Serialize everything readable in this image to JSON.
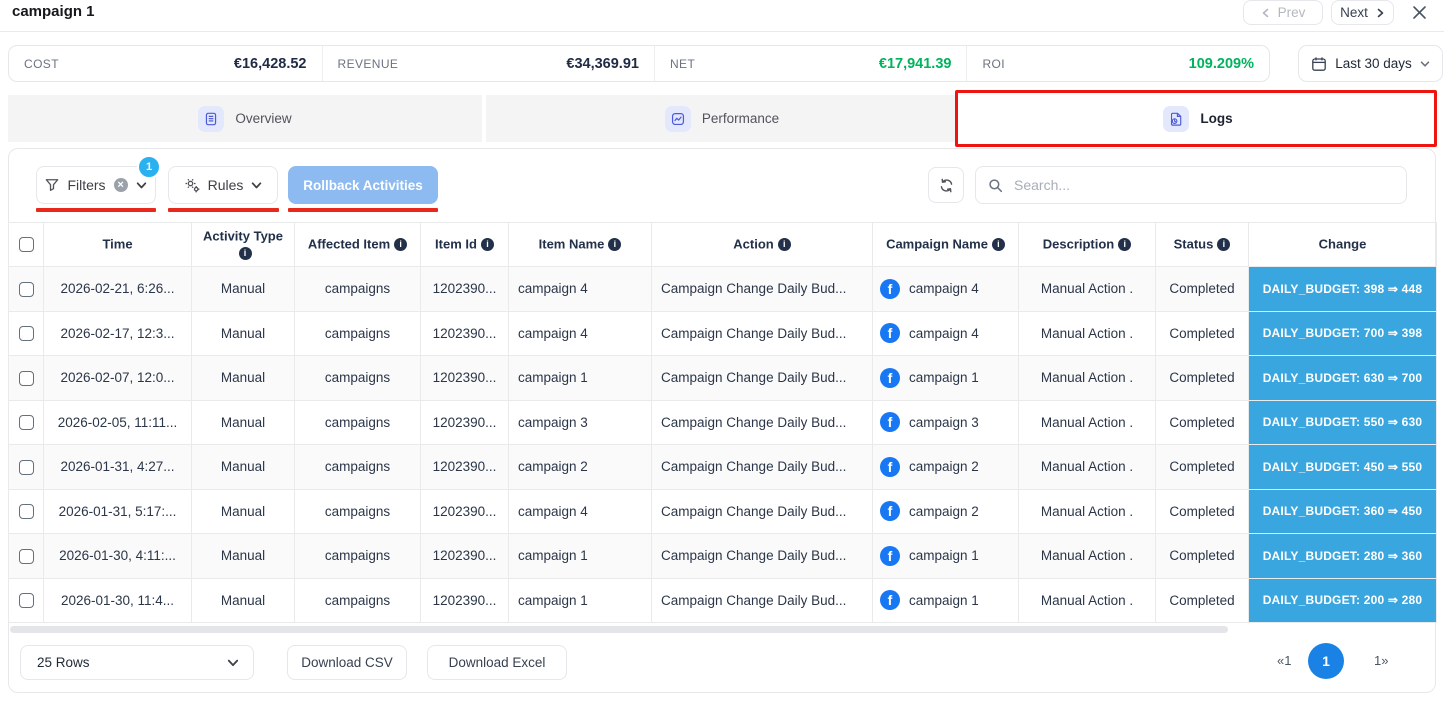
{
  "header": {
    "title": "campaign 1",
    "prev_label": "Prev",
    "next_label": "Next"
  },
  "stats": [
    {
      "label": "COST",
      "value": "€16,428.52"
    },
    {
      "label": "REVENUE",
      "value": "€34,369.91"
    },
    {
      "label": "NET",
      "value": "€17,941.39"
    },
    {
      "label": "ROI",
      "value": "109.209%"
    }
  ],
  "date_range": {
    "label": "Last 30 days"
  },
  "tabs": [
    {
      "label": "Overview",
      "active": false
    },
    {
      "label": "Performance",
      "active": false
    },
    {
      "label": "Logs",
      "active": true
    }
  ],
  "toolbar": {
    "filters_label": "Filters",
    "filters_badge": "1",
    "rules_label": "Rules",
    "rollback_label": "Rollback Activities",
    "search_placeholder": "Search..."
  },
  "icons": {
    "info": "i",
    "facebook": "f"
  },
  "table": {
    "columns": [
      {
        "key": "time",
        "label": "Time",
        "info": false
      },
      {
        "key": "activity_type",
        "label": "Activity Type",
        "info": true
      },
      {
        "key": "affected_item",
        "label": "Affected Item",
        "info": true
      },
      {
        "key": "item_id",
        "label": "Item Id",
        "info": true
      },
      {
        "key": "item_name",
        "label": "Item Name",
        "info": true
      },
      {
        "key": "action",
        "label": "Action",
        "info": true
      },
      {
        "key": "campaign_name",
        "label": "Campaign Name",
        "info": true
      },
      {
        "key": "description",
        "label": "Description",
        "info": true
      },
      {
        "key": "status",
        "label": "Status",
        "info": true
      },
      {
        "key": "change",
        "label": "Change",
        "info": false
      }
    ],
    "rows": [
      {
        "time": "2026-02-21, 6:26...",
        "activity_type": "Manual",
        "affected_item": "campaigns",
        "item_id": "1202390...",
        "item_name": "campaign 4",
        "action": "Campaign Change Daily Bud...",
        "campaign_name": "campaign 4",
        "description": "Manual Action .",
        "status": "Completed",
        "change": "DAILY_BUDGET: 398 ⇒ 448"
      },
      {
        "time": "2026-02-17, 12:3...",
        "activity_type": "Manual",
        "affected_item": "campaigns",
        "item_id": "1202390...",
        "item_name": "campaign 4",
        "action": "Campaign Change Daily Bud...",
        "campaign_name": "campaign 4",
        "description": "Manual Action .",
        "status": "Completed",
        "change": "DAILY_BUDGET: 700 ⇒ 398"
      },
      {
        "time": "2026-02-07, 12:0...",
        "activity_type": "Manual",
        "affected_item": "campaigns",
        "item_id": "1202390...",
        "item_name": "campaign 1",
        "action": "Campaign Change Daily Bud...",
        "campaign_name": "campaign 1",
        "description": "Manual Action .",
        "status": "Completed",
        "change": "DAILY_BUDGET: 630 ⇒ 700"
      },
      {
        "time": "2026-02-05, 11:11...",
        "activity_type": "Manual",
        "affected_item": "campaigns",
        "item_id": "1202390...",
        "item_name": "campaign 3",
        "action": "Campaign Change Daily Bud...",
        "campaign_name": "campaign 3",
        "description": "Manual Action .",
        "status": "Completed",
        "change": "DAILY_BUDGET: 550 ⇒ 630"
      },
      {
        "time": "2026-01-31, 4:27...",
        "activity_type": "Manual",
        "affected_item": "campaigns",
        "item_id": "1202390...",
        "item_name": "campaign 2",
        "action": "Campaign Change Daily Bud...",
        "campaign_name": "campaign 2",
        "description": "Manual Action .",
        "status": "Completed",
        "change": "DAILY_BUDGET: 450 ⇒ 550"
      },
      {
        "time": "2026-01-31, 5:17:...",
        "activity_type": "Manual",
        "affected_item": "campaigns",
        "item_id": "1202390...",
        "item_name": "campaign 4",
        "action": "Campaign Change Daily Bud...",
        "campaign_name": "campaign 2",
        "description": "Manual Action .",
        "status": "Completed",
        "change": "DAILY_BUDGET: 360 ⇒ 450"
      },
      {
        "time": "2026-01-30, 4:11:...",
        "activity_type": "Manual",
        "affected_item": "campaigns",
        "item_id": "1202390...",
        "item_name": "campaign 1",
        "action": "Campaign Change Daily Bud...",
        "campaign_name": "campaign 1",
        "description": "Manual Action .",
        "status": "Completed",
        "change": "DAILY_BUDGET: 280 ⇒ 360"
      },
      {
        "time": "2026-01-30, 11:4...",
        "activity_type": "Manual",
        "affected_item": "campaigns",
        "item_id": "1202390...",
        "item_name": "campaign 1",
        "action": "Campaign Change Daily Bud...",
        "campaign_name": "campaign 1",
        "description": "Manual Action .",
        "status": "Completed",
        "change": "DAILY_BUDGET: 200 ⇒ 280"
      }
    ]
  },
  "footer": {
    "rows_per_page": "25 Rows",
    "download_csv": "Download CSV",
    "download_excel": "Download Excel",
    "pagination": {
      "first": "«1",
      "current": "1",
      "last": "1»"
    }
  },
  "colors": {
    "net_roi_green": "#00b45e",
    "change_badge_blue": "#3aa6e0",
    "facebook_blue": "#1877f2",
    "filters_badge_blue": "#29b2ef",
    "rollback_button_blue": "#8cbaf1",
    "pagination_active_blue": "#1a82e4",
    "annotation_red": "#ee1410"
  }
}
